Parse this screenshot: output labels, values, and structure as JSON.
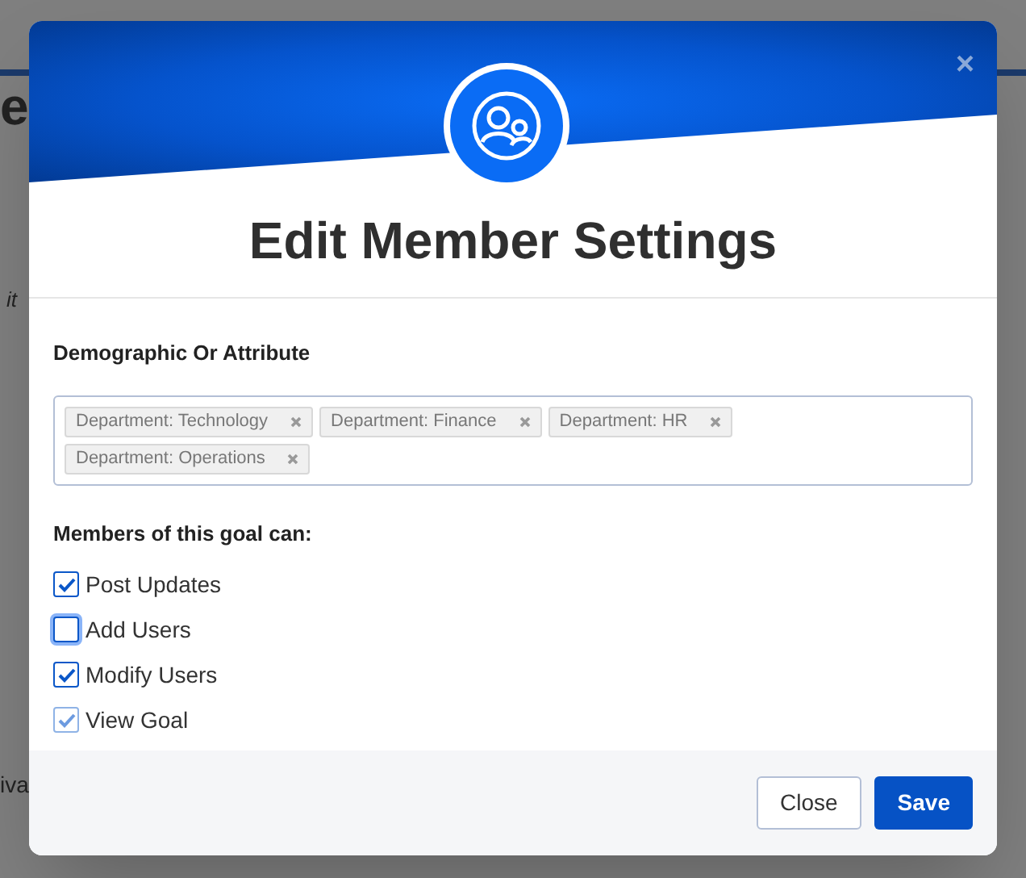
{
  "background_fragments": [
    {
      "kind": "heading",
      "text": "e"
    },
    {
      "kind": "italic",
      "text": "it"
    },
    {
      "kind": "plain",
      "text": "iva"
    }
  ],
  "dialog": {
    "title": "Edit Member Settings",
    "close_icon": "×",
    "field": {
      "label": "Demographic Or Attribute",
      "tags": [
        {
          "text": "Department: Technology"
        },
        {
          "text": "Department: Finance"
        },
        {
          "text": "Department: HR"
        },
        {
          "text": "Department: Operations"
        }
      ]
    },
    "permissions": {
      "label": "Members of this goal can:",
      "items": [
        {
          "label": "Post Updates",
          "checked": true,
          "disabled": false,
          "focused": false
        },
        {
          "label": "Add Users",
          "checked": false,
          "disabled": false,
          "focused": true
        },
        {
          "label": "Modify Users",
          "checked": true,
          "disabled": false,
          "focused": false
        },
        {
          "label": "View Goal",
          "checked": true,
          "disabled": true,
          "focused": false
        }
      ]
    },
    "buttons": [
      {
        "kind": "secondary",
        "label": "Close"
      },
      {
        "kind": "primary",
        "label": "Save"
      }
    ]
  }
}
